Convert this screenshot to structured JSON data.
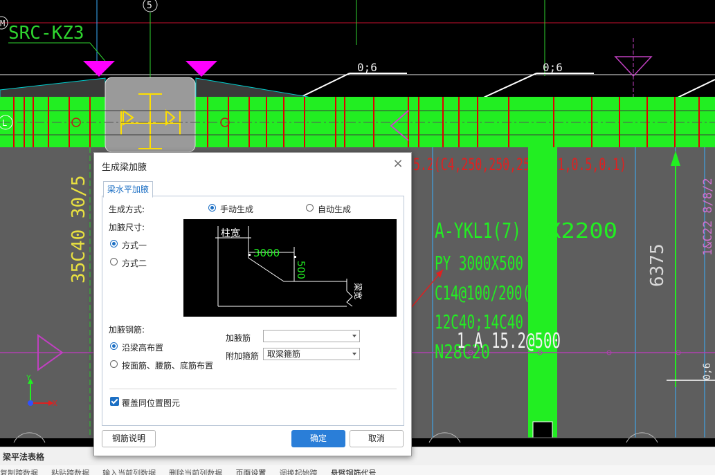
{
  "cad": {
    "col_label": "SRC-KZ3",
    "axis_number": "5",
    "axis_letter_m": "M",
    "axis_letter_l": "L",
    "slope_left": "0;6",
    "slope_right": "0;6",
    "slope_lower": "0;6",
    "beam_haunch_text": "5.2(C4,250,250,250,0.1,0.5,0.1)",
    "vertical_left": "35C40 30/5",
    "beam_name": "A-YKL1(7)",
    "beam_size": "X2200",
    "beam_py": "PY 3000X500",
    "stirrup": "C14@100/200(",
    "main_bars": "12C40;14C40",
    "extra": "1 A 15.2@500",
    "side_bars": "N28C20",
    "dim_6375": "6375",
    "right_vertical": "1&C22 8/8/2",
    "ucs_y": "Y",
    "ucs_x": "X"
  },
  "dialog": {
    "title": "生成梁加腋",
    "tab": "梁水平加腋",
    "gen_mode_label": "生成方式:",
    "manual": "手动生成",
    "auto": "自动生成",
    "size_label": "加腋尺寸:",
    "option1": "方式一",
    "option2": "方式二",
    "preview": {
      "col_width": "柱宽",
      "len": "3000",
      "height": "500",
      "beam_width": "梁宽"
    },
    "rebar_label": "加腋钢筋:",
    "along_height": "沿梁高布置",
    "by_faces": "按面筋、腰筋、底筋布置",
    "haunch_bar_label": "加腋筋",
    "haunch_bar_value": "",
    "stirrup_label": "附加箍筋",
    "stirrup_value": "取梁箍筋",
    "overwrite": "覆盖同位置图元",
    "help_button": "钢筋说明",
    "ok_button": "确定",
    "cancel_button": "取消"
  },
  "bottom_panel": {
    "title": "梁平法表格",
    "toolbar": [
      "复制跨数据",
      "粘贴跨数据",
      "输入当前列数据",
      "删除当前列数据",
      "页面设置",
      "调换起始跨",
      "悬臂钢筋代号"
    ]
  }
}
